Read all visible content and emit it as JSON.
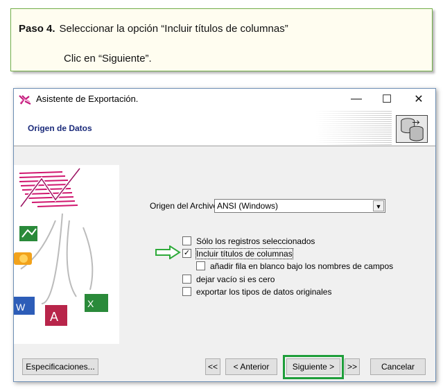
{
  "instruction": {
    "step_label": "Paso 4.",
    "line1": "Seleccionar la opción “Incluir títulos de columnas”",
    "line2": "Clic en “Siguiente”."
  },
  "window": {
    "title": "Asistente de Exportación.",
    "min": "—",
    "max": "☐",
    "close": "✕"
  },
  "header": {
    "title": "Origen de Datos"
  },
  "form": {
    "origin_label": "Origen del Archivo:",
    "origin_value": "ANSI (Windows)",
    "checkboxes": [
      {
        "label": "Sólo los registros seleccionados",
        "checked": false,
        "mark": ""
      },
      {
        "label": "Incluir títulos de columnas",
        "checked": true,
        "mark": "✓"
      },
      {
        "label": "añadir fila en blanco bajo los nombres de campos",
        "checked": false,
        "mark": ""
      },
      {
        "label": "dejar vacío si es cero",
        "checked": false,
        "mark": ""
      },
      {
        "label": "exportar los tipos de datos originales",
        "checked": false,
        "mark": ""
      }
    ]
  },
  "buttons": {
    "specs": "Especificaciones...",
    "first": "<<",
    "back": "< Anterior",
    "next": "Siguiente >",
    "last": ">>",
    "cancel": "Cancelar"
  },
  "colors": {
    "highlight": "#1e9e3a",
    "instruction_border": "#70ad47",
    "header_title": "#1a2a7a"
  }
}
